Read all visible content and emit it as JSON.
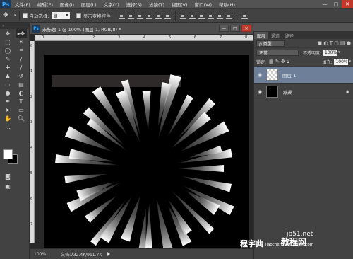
{
  "app": {
    "logo": "Ps"
  },
  "menu": [
    "文件(F)",
    "编辑(E)",
    "图像(I)",
    "图层(L)",
    "文字(Y)",
    "选择(S)",
    "滤镜(T)",
    "视图(V)",
    "窗口(W)",
    "帮助(H)"
  ],
  "window_controls": {
    "minimize": "—",
    "maximize": "□",
    "close": "✕"
  },
  "options": {
    "auto_select_label": "自动选择:",
    "auto_select_value": "组",
    "show_transform_label": "显示变换控件"
  },
  "document": {
    "tab_icon": "Ps",
    "title": "未标题-1 @ 100% (图层 1, RGB/8) *",
    "zoom": "100%",
    "doc_size": "文档:732.4K/911.7K",
    "ruler_top": [
      "0",
      "1",
      "2",
      "3",
      "4",
      "5",
      "6",
      "7",
      "8"
    ],
    "ruler_left": [
      "0",
      "1",
      "2",
      "3",
      "4",
      "5",
      "6",
      "7"
    ]
  },
  "panels": {
    "tabs": [
      "图层",
      "通道",
      "路径"
    ],
    "filter_kind": "ρ 类型",
    "blend_mode": "正常",
    "opacity_label": "不透明度:",
    "opacity_value": "100%",
    "lock_label": "锁定:",
    "fill_label": "填充:",
    "fill_value": "100%",
    "layers": [
      {
        "name": "图层 1",
        "selected": true
      },
      {
        "name": "背景",
        "selected": false
      }
    ]
  },
  "watermark": {
    "site": "jb51.net",
    "brand": "教程网",
    "url": "jiaocheng.chazidian.com",
    "prefix": "程字典"
  },
  "colors": {
    "foreground": "#ffffff",
    "background": "#000000",
    "selected_layer": "#6d7f99",
    "canvas": "#000000"
  }
}
